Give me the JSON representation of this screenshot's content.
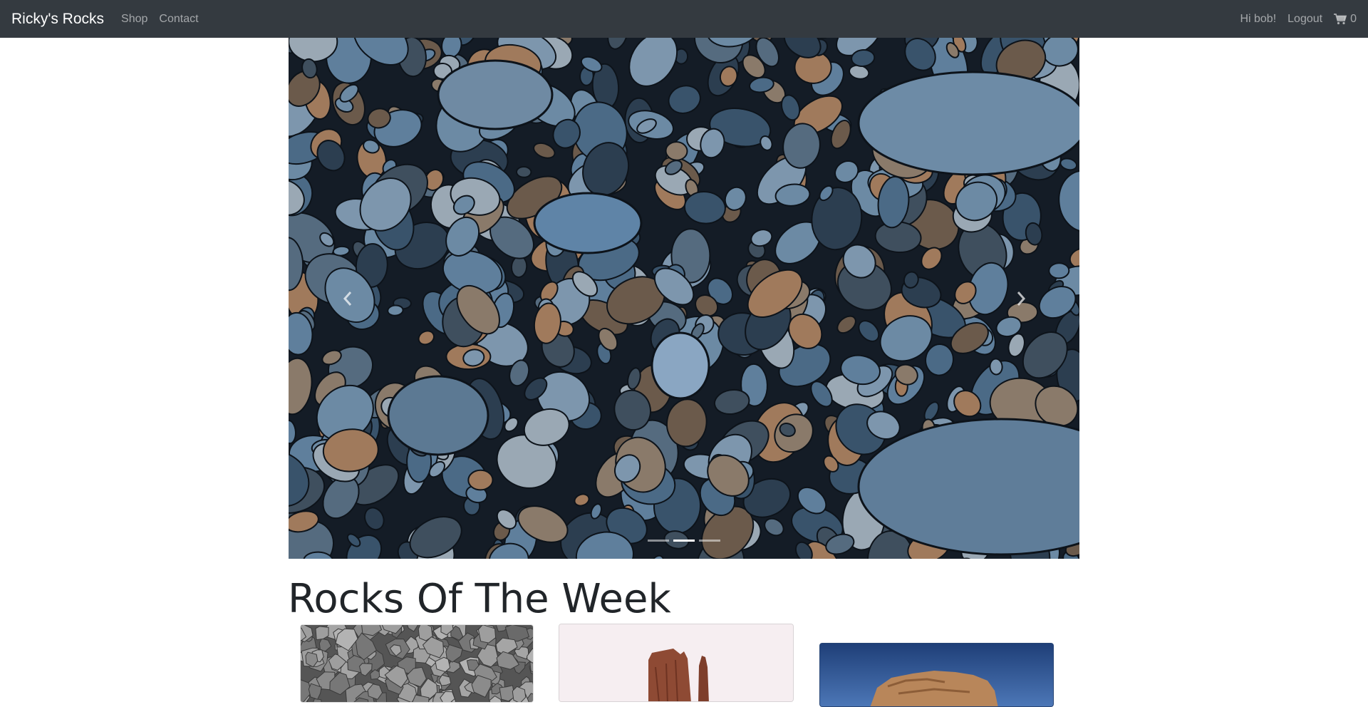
{
  "navbar": {
    "brand": "Ricky's Rocks",
    "links": [
      "Shop",
      "Contact"
    ],
    "greeting": "Hi bob!",
    "logout": "Logout",
    "cart_count": "0",
    "cart_icon": "shopping-cart-icon"
  },
  "carousel": {
    "prev_icon": "chevron-left-icon",
    "next_icon": "chevron-right-icon",
    "indicator_count": 3,
    "active_indicator": 2
  },
  "rocks_of_week": {
    "title": "Rocks Of The Week",
    "cards": [
      {
        "image": "gravel-rocks"
      },
      {
        "image": "red-butte"
      },
      {
        "image": "desert-rock-formation"
      }
    ]
  },
  "colors": {
    "navbar_bg": "#343a40",
    "navbar_text": "#ffffff",
    "nav_link": "rgba(255,255,255,0.55)"
  }
}
